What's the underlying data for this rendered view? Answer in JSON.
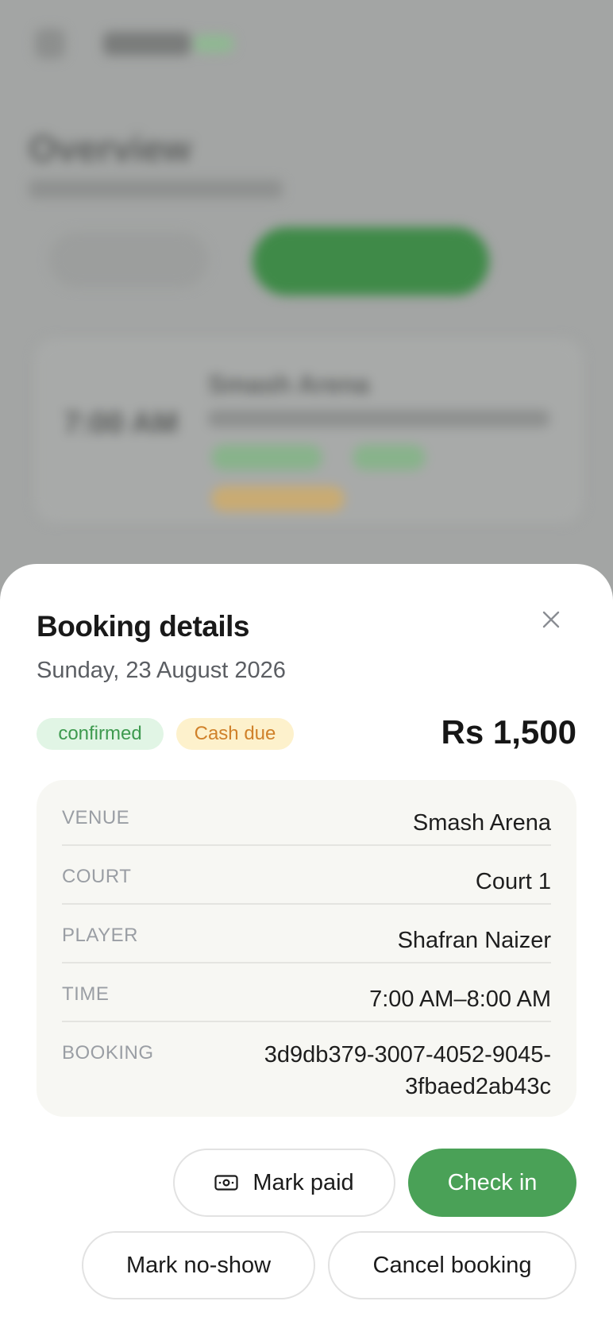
{
  "background": {
    "page_title": "Overview",
    "card_time": "7:00 AM",
    "card_venue": "Smash Arena"
  },
  "sheet": {
    "title": "Booking details",
    "date": "Sunday, 23 August 2026",
    "status_badge": "confirmed",
    "payment_badge": "Cash due",
    "amount": "Rs 1,500",
    "details": {
      "venue_label": "VENUE",
      "venue_value": "Smash Arena",
      "court_label": "COURT",
      "court_value": "Court 1",
      "player_label": "PLAYER",
      "player_value": "Shafran Naizer",
      "time_label": "TIME",
      "time_value": "7:00 AM–8:00 AM",
      "booking_label": "BOOKING",
      "booking_value": "3d9db379-3007-4052-9045-3fbaed2ab43c"
    },
    "actions": {
      "mark_paid": "Mark paid",
      "check_in": "Check in",
      "mark_no_show": "Mark no-show",
      "cancel_booking": "Cancel booking"
    }
  },
  "colors": {
    "accent_green": "#4aa157",
    "confirmed_bg": "#e1f5e5",
    "confirmed_text": "#3e9a4f",
    "cash_bg": "#fdf1cc",
    "cash_text": "#d0812a",
    "overlay": "#a3a5a4"
  },
  "icons": {
    "close": "close-icon",
    "cash": "cash-icon"
  }
}
